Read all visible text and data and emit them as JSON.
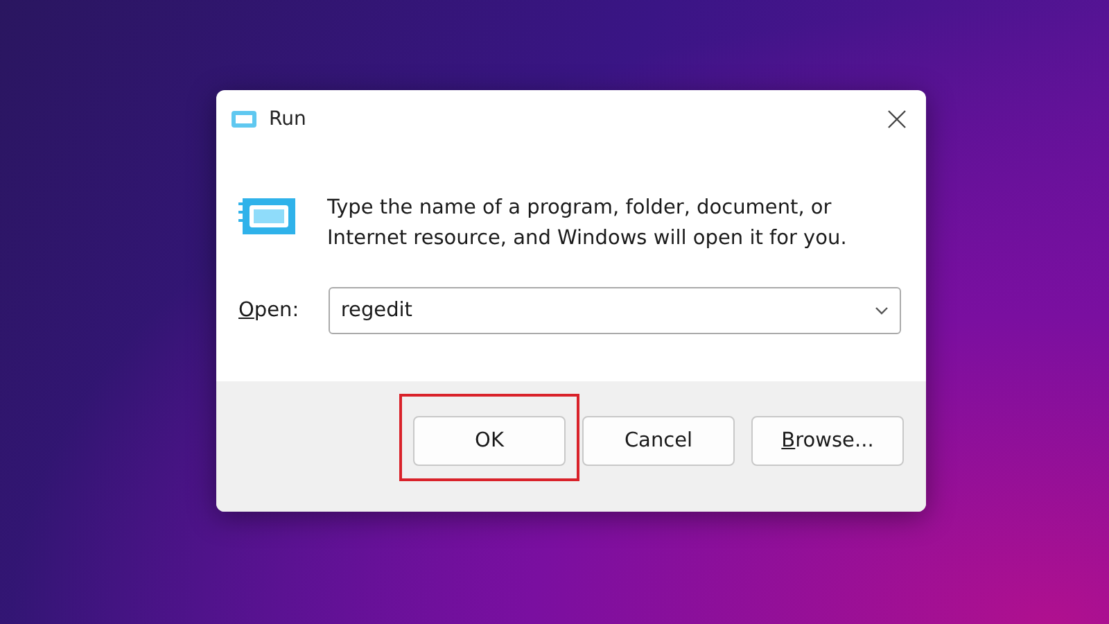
{
  "window": {
    "title": "Run"
  },
  "message": "Type the name of a program, folder, document, or Internet resource, and Windows will open it for you.",
  "open_field": {
    "label": "Open:",
    "value": "regedit"
  },
  "buttons": [
    {
      "label": "OK",
      "highlighted": true
    },
    {
      "label": "Cancel",
      "highlighted": false
    },
    {
      "label": "Browse...",
      "highlighted": false
    }
  ]
}
